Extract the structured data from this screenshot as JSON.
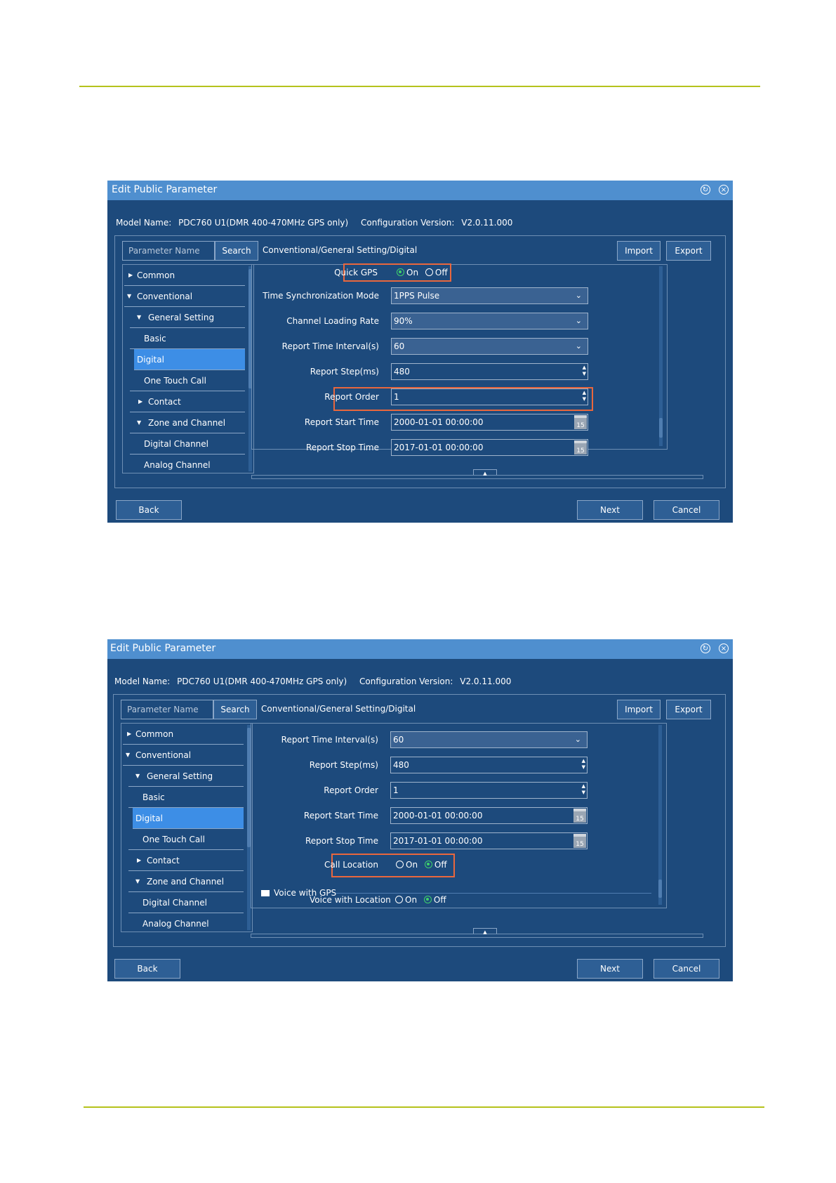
{
  "screens": [
    {
      "title": "Edit Public Parameter",
      "model_label": "Model Name:",
      "model_value": "PDC760 U1(DMR 400-470MHz GPS only)",
      "config_label": "Configuration Version:",
      "config_value": "V2.0.11.000",
      "search_placeholder": "Parameter Name",
      "search_label": "Search",
      "breadcrumb": "Conventional/General Setting/Digital",
      "import_label": "Import",
      "export_label": "Export",
      "nav": [
        "Common",
        "Conventional",
        "General Setting",
        "Basic",
        "Digital",
        "One Touch Call",
        "Contact",
        "Zone and Channel",
        "Digital Channel",
        "Analog Channel"
      ],
      "quick_gps": {
        "label": "Quick GPS",
        "on": "On",
        "off": "Off",
        "selected": "On"
      },
      "time_sync": {
        "label": "Time Synchronization Mode",
        "value": "1PPS Pulse"
      },
      "channel_rate": {
        "label": "Channel Loading Rate",
        "value": "90%"
      },
      "report_interval": {
        "label": "Report Time Interval(s)",
        "value": "60"
      },
      "report_step": {
        "label": "Report Step(ms)",
        "value": "480"
      },
      "report_order": {
        "label": "Report Order",
        "value": "1"
      },
      "report_start": {
        "label": "Report Start Time",
        "value": "2000-01-01 00:00:00"
      },
      "report_stop": {
        "label": "Report Stop Time",
        "value": "2017-01-01 00:00:00"
      },
      "calendar_day": "15",
      "back_label": "Back",
      "next_label": "Next",
      "cancel_label": "Cancel"
    },
    {
      "title": "Edit Public Parameter",
      "model_label": "Model Name:",
      "model_value": "PDC760 U1(DMR 400-470MHz GPS only)",
      "config_label": "Configuration Version:",
      "config_value": "V2.0.11.000",
      "search_placeholder": "Parameter Name",
      "search_label": "Search",
      "breadcrumb": "Conventional/General Setting/Digital",
      "import_label": "Import",
      "export_label": "Export",
      "nav": [
        "Common",
        "Conventional",
        "General Setting",
        "Basic",
        "Digital",
        "One Touch Call",
        "Contact",
        "Zone and Channel",
        "Digital Channel",
        "Analog Channel"
      ],
      "report_interval": {
        "label": "Report Time Interval(s)",
        "value": "60"
      },
      "report_step": {
        "label": "Report Step(ms)",
        "value": "480"
      },
      "report_order": {
        "label": "Report Order",
        "value": "1"
      },
      "report_start": {
        "label": "Report Start Time",
        "value": "2000-01-01 00:00:00"
      },
      "report_stop": {
        "label": "Report Stop Time",
        "value": "2017-01-01 00:00:00"
      },
      "calendar_day": "15",
      "call_location": {
        "label": "Call Location",
        "on": "On",
        "off": "Off",
        "selected": "Off"
      },
      "voice_gps_group": "Voice with GPS",
      "voice_location": {
        "label": "Voice with Location",
        "on": "On",
        "off": "Off",
        "selected": "Off"
      },
      "back_label": "Back",
      "next_label": "Next",
      "cancel_label": "Cancel"
    }
  ],
  "colors": {
    "window_bg": "#1d4a7c",
    "titlebar": "#4f8fcf",
    "selected": "#3d8ee6",
    "highlight": "#e9673d",
    "rule": "#b5c21c",
    "radio_on": "#3fd26b"
  }
}
